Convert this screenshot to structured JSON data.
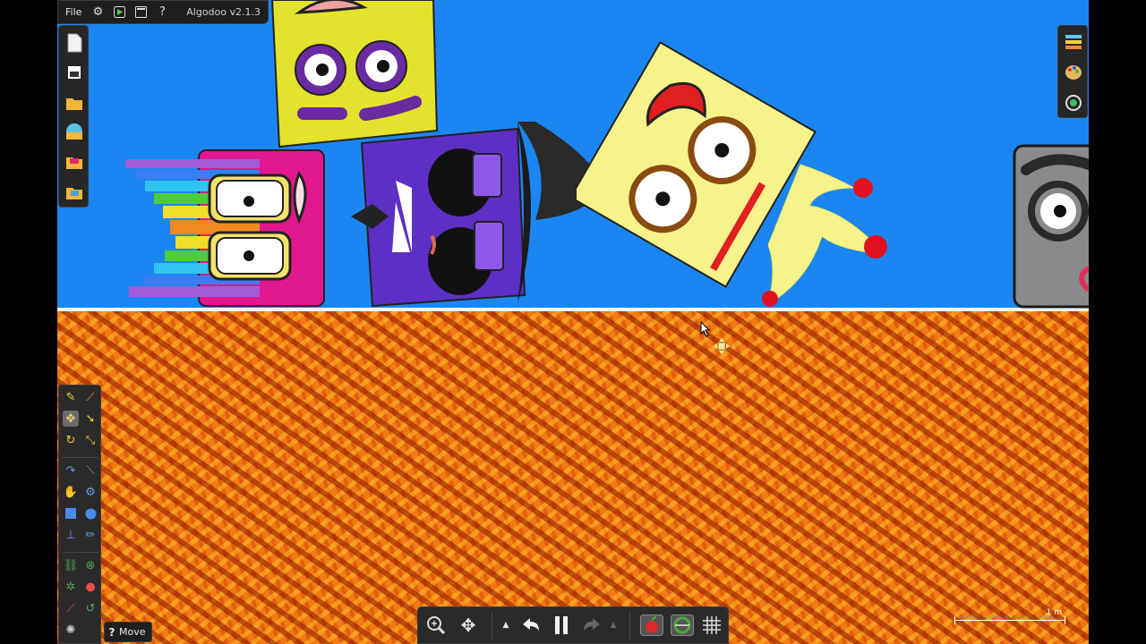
{
  "app": {
    "title": "Algodoo",
    "version_label": "Algodoo v2.1.3"
  },
  "menu": {
    "file_label": "File"
  },
  "topbar_icons": [
    "gear-icon",
    "play-scene-icon",
    "window-icon",
    "help-icon"
  ],
  "file_panel": [
    "new-scene-icon",
    "clear-scene-icon",
    "open-folder-icon",
    "scene-browser-icon",
    "phunlets-icon",
    "scene-folder-icon"
  ],
  "right_panel": [
    "layers-icon",
    "appearance-palette-icon",
    "zoom-to-fit-icon"
  ],
  "tools": [
    "sketch-tool",
    "cut-tool",
    "move-tool",
    "drag-tool",
    "rotate-tool",
    "scale-tool",
    "rope-tool",
    "knife-tool",
    "hand-tool",
    "gear-tool",
    "box-tool",
    "circle-tool",
    "plane-tool",
    "brush-tool",
    "chain-tool",
    "axle-tool",
    "thruster-tool",
    "fixate-tool",
    "laser-tool",
    "spring-tool",
    "tracer-tool"
  ],
  "selected_tool": "move-tool",
  "status": {
    "tool_name": "Move",
    "help_label": "?"
  },
  "bottom_bar": [
    "zoom-icon",
    "pan-icon",
    "undo-menu-icon",
    "undo-icon",
    "pause-icon",
    "redo-icon",
    "redo-menu-icon",
    "gravity-icon",
    "air-friction-icon",
    "grid-icon"
  ],
  "simulation": {
    "state": "running"
  },
  "scale_bar": {
    "label": "1 m"
  },
  "colors": {
    "sky": "#1b86f2",
    "lava": "#f07a14",
    "panel": "#262626"
  }
}
